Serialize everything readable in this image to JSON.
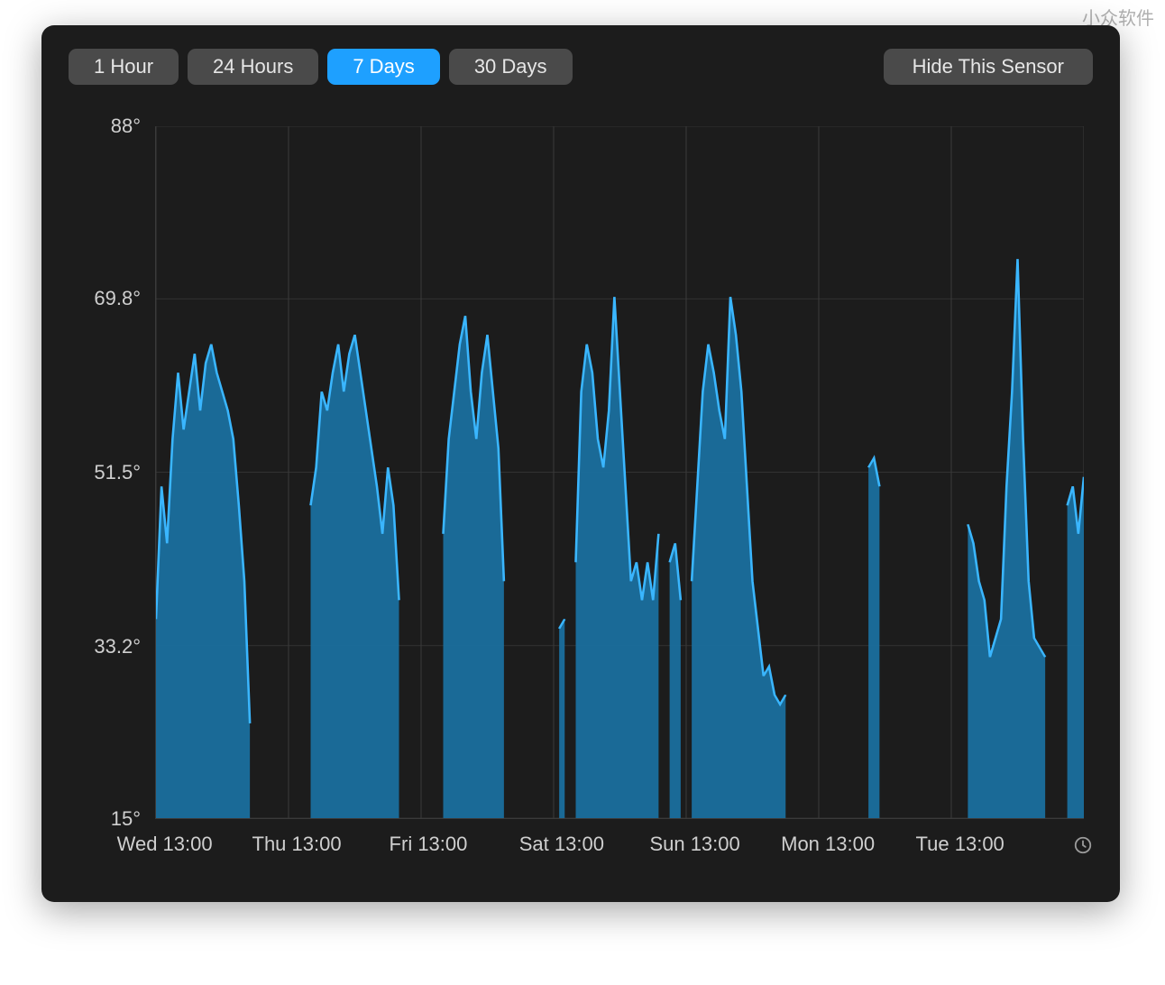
{
  "watermark": "小众软件",
  "toolbar": {
    "ranges": [
      {
        "label": "1 Hour",
        "active": false
      },
      {
        "label": "24 Hours",
        "active": false
      },
      {
        "label": "7 Days",
        "active": true
      },
      {
        "label": "30 Days",
        "active": false
      }
    ],
    "hide_label": "Hide This Sensor"
  },
  "chart_data": {
    "type": "area",
    "ylabel": "",
    "xlabel": "",
    "ylim": [
      15,
      88
    ],
    "yticks": [
      15,
      33.2,
      51.5,
      69.8,
      88
    ],
    "ytick_labels": [
      "15°",
      "33.2°",
      "51.5°",
      "69.8°",
      "88°"
    ],
    "xticks": [
      0,
      24,
      48,
      72,
      96,
      120,
      144
    ],
    "xtick_labels": [
      "Wed 13:00",
      "Thu 13:00",
      "Fri 13:00",
      "Sat 13:00",
      "Sun 13:00",
      "Mon 13:00",
      "Tue 13:00"
    ],
    "xlim": [
      0,
      168
    ],
    "grid_x": [
      0,
      24,
      48,
      72,
      96,
      120,
      144,
      168
    ],
    "grid_y": [
      15,
      33.2,
      51.5,
      69.8,
      88
    ],
    "series": [
      {
        "name": "sensor-temperature",
        "color_fill": "#1a6f9e",
        "color_stroke": "#3ab6ff",
        "x": [
          0,
          1,
          2,
          3,
          4,
          5,
          6,
          7,
          8,
          9,
          10,
          11,
          12,
          13,
          14,
          15,
          16,
          17,
          18,
          19,
          20,
          21,
          22,
          23,
          24,
          25,
          26,
          27,
          28,
          29,
          30,
          31,
          32,
          33,
          34,
          35,
          36,
          37,
          38,
          39,
          40,
          41,
          42,
          43,
          44,
          45,
          46,
          47,
          48,
          49,
          50,
          51,
          52,
          53,
          54,
          55,
          56,
          57,
          58,
          59,
          60,
          61,
          62,
          63,
          64,
          65,
          66,
          67,
          68,
          69,
          70,
          71,
          72,
          73,
          74,
          75,
          76,
          77,
          78,
          79,
          80,
          81,
          82,
          83,
          84,
          85,
          86,
          87,
          88,
          89,
          90,
          91,
          92,
          93,
          94,
          95,
          96,
          97,
          98,
          99,
          100,
          101,
          102,
          103,
          104,
          105,
          106,
          107,
          108,
          109,
          110,
          111,
          112,
          113,
          114,
          115,
          116,
          117,
          118,
          119,
          120,
          121,
          122,
          123,
          124,
          125,
          126,
          127,
          128,
          129,
          130,
          131,
          132,
          133,
          134,
          135,
          136,
          137,
          138,
          139,
          140,
          141,
          142,
          143,
          144,
          145,
          146,
          147,
          148,
          149,
          150,
          151,
          152,
          153,
          154,
          155,
          156,
          157,
          158,
          159,
          160,
          161,
          162,
          163,
          164,
          165,
          166,
          167,
          168
        ],
        "values": [
          36,
          50,
          44,
          55,
          62,
          56,
          60,
          64,
          58,
          63,
          65,
          62,
          60,
          58,
          55,
          48,
          40,
          25,
          null,
          null,
          31,
          null,
          null,
          null,
          null,
          null,
          null,
          null,
          48,
          52,
          60,
          58,
          62,
          65,
          60,
          64,
          66,
          62,
          58,
          54,
          50,
          45,
          52,
          48,
          38,
          null,
          null,
          null,
          null,
          null,
          null,
          null,
          45,
          55,
          60,
          65,
          68,
          60,
          55,
          62,
          66,
          60,
          54,
          40,
          null,
          28,
          null,
          null,
          null,
          null,
          null,
          null,
          null,
          35,
          36,
          null,
          42,
          60,
          65,
          62,
          55,
          52,
          58,
          70,
          60,
          50,
          40,
          42,
          38,
          42,
          38,
          45,
          null,
          42,
          44,
          38,
          null,
          40,
          50,
          60,
          65,
          62,
          58,
          55,
          70,
          66,
          60,
          50,
          40,
          35,
          30,
          31,
          28,
          27,
          28,
          null,
          null,
          null,
          null,
          null,
          null,
          null,
          null,
          null,
          null,
          null,
          null,
          null,
          null,
          52,
          53,
          50,
          null,
          null,
          null,
          25,
          null,
          null,
          null,
          null,
          null,
          null,
          null,
          null,
          null,
          null,
          null,
          46,
          44,
          40,
          38,
          32,
          34,
          36,
          50,
          60,
          74,
          55,
          40,
          34,
          33,
          32,
          null,
          28,
          null,
          48,
          50,
          45,
          51
        ]
      }
    ]
  }
}
